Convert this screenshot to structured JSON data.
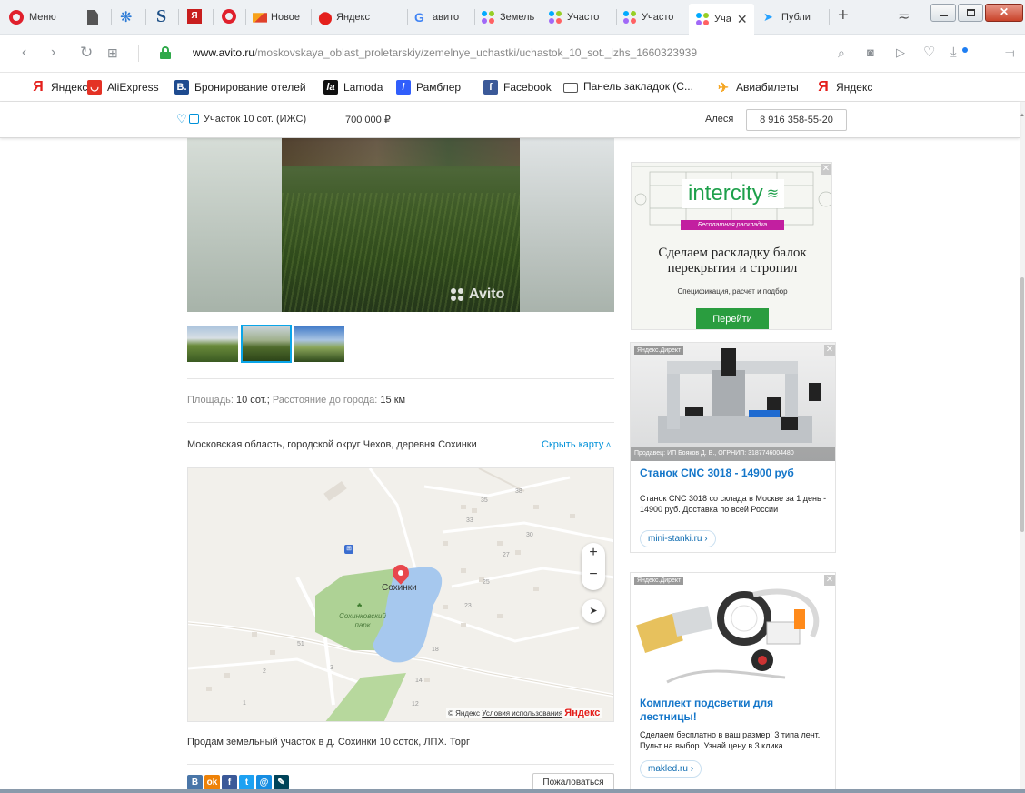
{
  "browser": {
    "menu_label": "Меню",
    "tabs": [
      {
        "label": "Новое"
      },
      {
        "label": "Яндекс"
      },
      {
        "label": "авито"
      },
      {
        "label": "Земель"
      },
      {
        "label": "Участо"
      },
      {
        "label": "Участо"
      },
      {
        "label": "Уча"
      },
      {
        "label": "Публи"
      }
    ],
    "url_domain": "www.avito.ru",
    "url_path": "/moskovskaya_oblast_proletarskiy/zemelnye_uchastki/uchastok_10_sot._izhs_1660323939",
    "bookmarks": [
      {
        "label": "Яндекс",
        "icon": "yandex-icon",
        "color": "#e4201c"
      },
      {
        "label": "AliExpress",
        "icon": "aliexpress-icon",
        "color": "#e43225"
      },
      {
        "label": "Бронирование отелей",
        "icon": "booking-icon",
        "color": "#1e4b8f"
      },
      {
        "label": "Lamoda",
        "icon": "lamoda-icon",
        "color": "#111111"
      },
      {
        "label": "Рамблер",
        "icon": "rambler-icon",
        "color": "#315efb"
      },
      {
        "label": "Facebook",
        "icon": "facebook-icon",
        "color": "#3b5998"
      },
      {
        "label": "Панель закладок (С...",
        "icon": "folder-icon",
        "color": "#555555"
      },
      {
        "label": "Авиабилеты",
        "icon": "plane-icon",
        "color": "#f5a623"
      },
      {
        "label": "Яндекс",
        "icon": "yandex-icon",
        "color": "#e4201c"
      }
    ]
  },
  "header": {
    "title": "Участок 10 сот. (ИЖС)",
    "price": "700 000",
    "currency": "₽",
    "seller": "Алеся",
    "phone": "8 916 358-55-20"
  },
  "listing": {
    "watermark": "Avito",
    "params": {
      "area_label": "Площадь:",
      "area_value": "10 сот.",
      "sep": ";",
      "distance_label": "Расстояние до города:",
      "distance_value": "15 км"
    },
    "address": "Московская область, городской округ Чехов, деревня Сохинки",
    "hide_map": "Скрыть карту",
    "description": "Продам земельный участок в д. Сохинки 10 соток, ЛПХ. Торг",
    "report_button": "Пожаловаться"
  },
  "map": {
    "place_label": "Сохинки",
    "park_label": "Сохинковский парк",
    "copyright": "© Яндекс",
    "terms": "Условия использования",
    "logo": "Яндекс",
    "house_numbers": [
      "35",
      "38",
      "33",
      "30",
      "27",
      "25",
      "23",
      "18",
      "14",
      "12",
      "51",
      "2",
      "3",
      "1"
    ],
    "zoom_in": "+",
    "zoom_out": "−"
  },
  "ads": {
    "intercity": {
      "brand": "intercity",
      "ribbon": "Бесплатная раскладка",
      "headline": "Сделаем раскладку балок перекрытия и стропил",
      "sub": "Спецификация, расчет и подбор",
      "button": "Перейти"
    },
    "cnc": {
      "tag": "Яндекс.Директ",
      "seller": "Продавец: ИП Бояков Д. В., ОГРНИП: 3187746004480",
      "title": "Станок CNC 3018 - 14900 руб",
      "text": "Станок CNC 3018 со склада в Москве за 1 день - 14900 руб. Доставка по всей России",
      "link": "mini-stanki.ru"
    },
    "led": {
      "tag": "Яндекс.Директ",
      "title": "Комплект подсветки для лестницы!",
      "text": "Сделаем бесплатно в ваш размер! 3 типа лент. Пульт на выбор. Узнай цену в 3 клика",
      "link": "makled.ru"
    }
  },
  "share": [
    {
      "name": "vk",
      "label": "В",
      "color": "#4a76a8"
    },
    {
      "name": "ok",
      "label": "ok",
      "color": "#ee8208"
    },
    {
      "name": "fb",
      "label": "f",
      "color": "#3b5998"
    },
    {
      "name": "tw",
      "label": "t",
      "color": "#1da1f2"
    },
    {
      "name": "mail",
      "label": "@",
      "color": "#168de2"
    },
    {
      "name": "lj",
      "label": "✎",
      "color": "#004359"
    }
  ]
}
